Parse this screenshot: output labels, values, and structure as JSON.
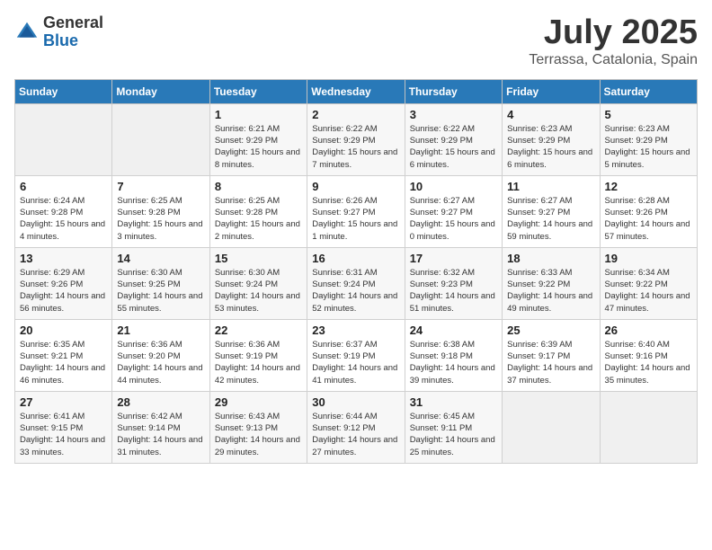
{
  "logo": {
    "general": "General",
    "blue": "Blue"
  },
  "title": {
    "month": "July 2025",
    "location": "Terrassa, Catalonia, Spain"
  },
  "weekdays": [
    "Sunday",
    "Monday",
    "Tuesday",
    "Wednesday",
    "Thursday",
    "Friday",
    "Saturday"
  ],
  "weeks": [
    [
      {
        "day": null
      },
      {
        "day": null
      },
      {
        "day": 1,
        "sunrise": "Sunrise: 6:21 AM",
        "sunset": "Sunset: 9:29 PM",
        "daylight": "Daylight: 15 hours and 8 minutes."
      },
      {
        "day": 2,
        "sunrise": "Sunrise: 6:22 AM",
        "sunset": "Sunset: 9:29 PM",
        "daylight": "Daylight: 15 hours and 7 minutes."
      },
      {
        "day": 3,
        "sunrise": "Sunrise: 6:22 AM",
        "sunset": "Sunset: 9:29 PM",
        "daylight": "Daylight: 15 hours and 6 minutes."
      },
      {
        "day": 4,
        "sunrise": "Sunrise: 6:23 AM",
        "sunset": "Sunset: 9:29 PM",
        "daylight": "Daylight: 15 hours and 6 minutes."
      },
      {
        "day": 5,
        "sunrise": "Sunrise: 6:23 AM",
        "sunset": "Sunset: 9:29 PM",
        "daylight": "Daylight: 15 hours and 5 minutes."
      }
    ],
    [
      {
        "day": 6,
        "sunrise": "Sunrise: 6:24 AM",
        "sunset": "Sunset: 9:28 PM",
        "daylight": "Daylight: 15 hours and 4 minutes."
      },
      {
        "day": 7,
        "sunrise": "Sunrise: 6:25 AM",
        "sunset": "Sunset: 9:28 PM",
        "daylight": "Daylight: 15 hours and 3 minutes."
      },
      {
        "day": 8,
        "sunrise": "Sunrise: 6:25 AM",
        "sunset": "Sunset: 9:28 PM",
        "daylight": "Daylight: 15 hours and 2 minutes."
      },
      {
        "day": 9,
        "sunrise": "Sunrise: 6:26 AM",
        "sunset": "Sunset: 9:27 PM",
        "daylight": "Daylight: 15 hours and 1 minute."
      },
      {
        "day": 10,
        "sunrise": "Sunrise: 6:27 AM",
        "sunset": "Sunset: 9:27 PM",
        "daylight": "Daylight: 15 hours and 0 minutes."
      },
      {
        "day": 11,
        "sunrise": "Sunrise: 6:27 AM",
        "sunset": "Sunset: 9:27 PM",
        "daylight": "Daylight: 14 hours and 59 minutes."
      },
      {
        "day": 12,
        "sunrise": "Sunrise: 6:28 AM",
        "sunset": "Sunset: 9:26 PM",
        "daylight": "Daylight: 14 hours and 57 minutes."
      }
    ],
    [
      {
        "day": 13,
        "sunrise": "Sunrise: 6:29 AM",
        "sunset": "Sunset: 9:26 PM",
        "daylight": "Daylight: 14 hours and 56 minutes."
      },
      {
        "day": 14,
        "sunrise": "Sunrise: 6:30 AM",
        "sunset": "Sunset: 9:25 PM",
        "daylight": "Daylight: 14 hours and 55 minutes."
      },
      {
        "day": 15,
        "sunrise": "Sunrise: 6:30 AM",
        "sunset": "Sunset: 9:24 PM",
        "daylight": "Daylight: 14 hours and 53 minutes."
      },
      {
        "day": 16,
        "sunrise": "Sunrise: 6:31 AM",
        "sunset": "Sunset: 9:24 PM",
        "daylight": "Daylight: 14 hours and 52 minutes."
      },
      {
        "day": 17,
        "sunrise": "Sunrise: 6:32 AM",
        "sunset": "Sunset: 9:23 PM",
        "daylight": "Daylight: 14 hours and 51 minutes."
      },
      {
        "day": 18,
        "sunrise": "Sunrise: 6:33 AM",
        "sunset": "Sunset: 9:22 PM",
        "daylight": "Daylight: 14 hours and 49 minutes."
      },
      {
        "day": 19,
        "sunrise": "Sunrise: 6:34 AM",
        "sunset": "Sunset: 9:22 PM",
        "daylight": "Daylight: 14 hours and 47 minutes."
      }
    ],
    [
      {
        "day": 20,
        "sunrise": "Sunrise: 6:35 AM",
        "sunset": "Sunset: 9:21 PM",
        "daylight": "Daylight: 14 hours and 46 minutes."
      },
      {
        "day": 21,
        "sunrise": "Sunrise: 6:36 AM",
        "sunset": "Sunset: 9:20 PM",
        "daylight": "Daylight: 14 hours and 44 minutes."
      },
      {
        "day": 22,
        "sunrise": "Sunrise: 6:36 AM",
        "sunset": "Sunset: 9:19 PM",
        "daylight": "Daylight: 14 hours and 42 minutes."
      },
      {
        "day": 23,
        "sunrise": "Sunrise: 6:37 AM",
        "sunset": "Sunset: 9:19 PM",
        "daylight": "Daylight: 14 hours and 41 minutes."
      },
      {
        "day": 24,
        "sunrise": "Sunrise: 6:38 AM",
        "sunset": "Sunset: 9:18 PM",
        "daylight": "Daylight: 14 hours and 39 minutes."
      },
      {
        "day": 25,
        "sunrise": "Sunrise: 6:39 AM",
        "sunset": "Sunset: 9:17 PM",
        "daylight": "Daylight: 14 hours and 37 minutes."
      },
      {
        "day": 26,
        "sunrise": "Sunrise: 6:40 AM",
        "sunset": "Sunset: 9:16 PM",
        "daylight": "Daylight: 14 hours and 35 minutes."
      }
    ],
    [
      {
        "day": 27,
        "sunrise": "Sunrise: 6:41 AM",
        "sunset": "Sunset: 9:15 PM",
        "daylight": "Daylight: 14 hours and 33 minutes."
      },
      {
        "day": 28,
        "sunrise": "Sunrise: 6:42 AM",
        "sunset": "Sunset: 9:14 PM",
        "daylight": "Daylight: 14 hours and 31 minutes."
      },
      {
        "day": 29,
        "sunrise": "Sunrise: 6:43 AM",
        "sunset": "Sunset: 9:13 PM",
        "daylight": "Daylight: 14 hours and 29 minutes."
      },
      {
        "day": 30,
        "sunrise": "Sunrise: 6:44 AM",
        "sunset": "Sunset: 9:12 PM",
        "daylight": "Daylight: 14 hours and 27 minutes."
      },
      {
        "day": 31,
        "sunrise": "Sunrise: 6:45 AM",
        "sunset": "Sunset: 9:11 PM",
        "daylight": "Daylight: 14 hours and 25 minutes."
      },
      {
        "day": null
      },
      {
        "day": null
      }
    ]
  ]
}
